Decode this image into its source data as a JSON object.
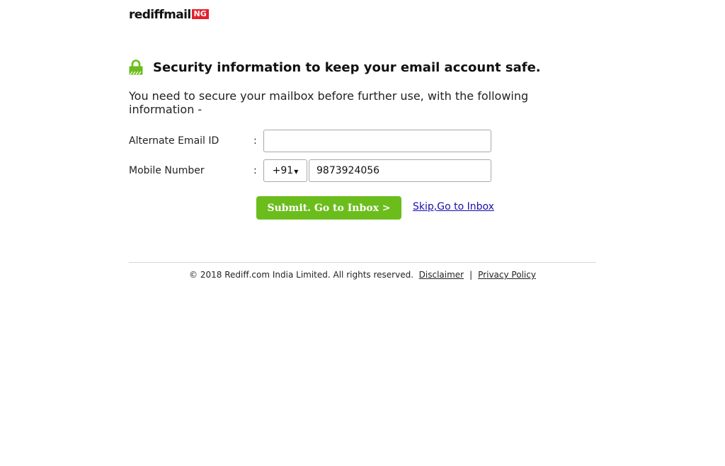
{
  "brand": {
    "name": "rediffmail",
    "badge": "NG",
    "badge_color": "#e4202e"
  },
  "header": {
    "icon": "lock-icon",
    "icon_color": "#6bbd1c",
    "title": "Security information to keep your email account safe."
  },
  "intro": "You need to secure your mailbox before further use, with the following information -",
  "form": {
    "email": {
      "label": "Alternate Email ID",
      "colon": ":",
      "value": ""
    },
    "mobile": {
      "label": "Mobile Number",
      "colon": ":",
      "country_code": "+91",
      "value": "9873924056"
    }
  },
  "actions": {
    "submit_label": "Submit. Go to Inbox >",
    "submit_color": "#6bbd1c",
    "skip_label": "Skip,Go to Inbox"
  },
  "footer": {
    "copyright": "© 2018 Rediff.com India Limited. All rights reserved.",
    "disclaimer": "Disclaimer",
    "separator": "|",
    "privacy": "Privacy Policy"
  }
}
